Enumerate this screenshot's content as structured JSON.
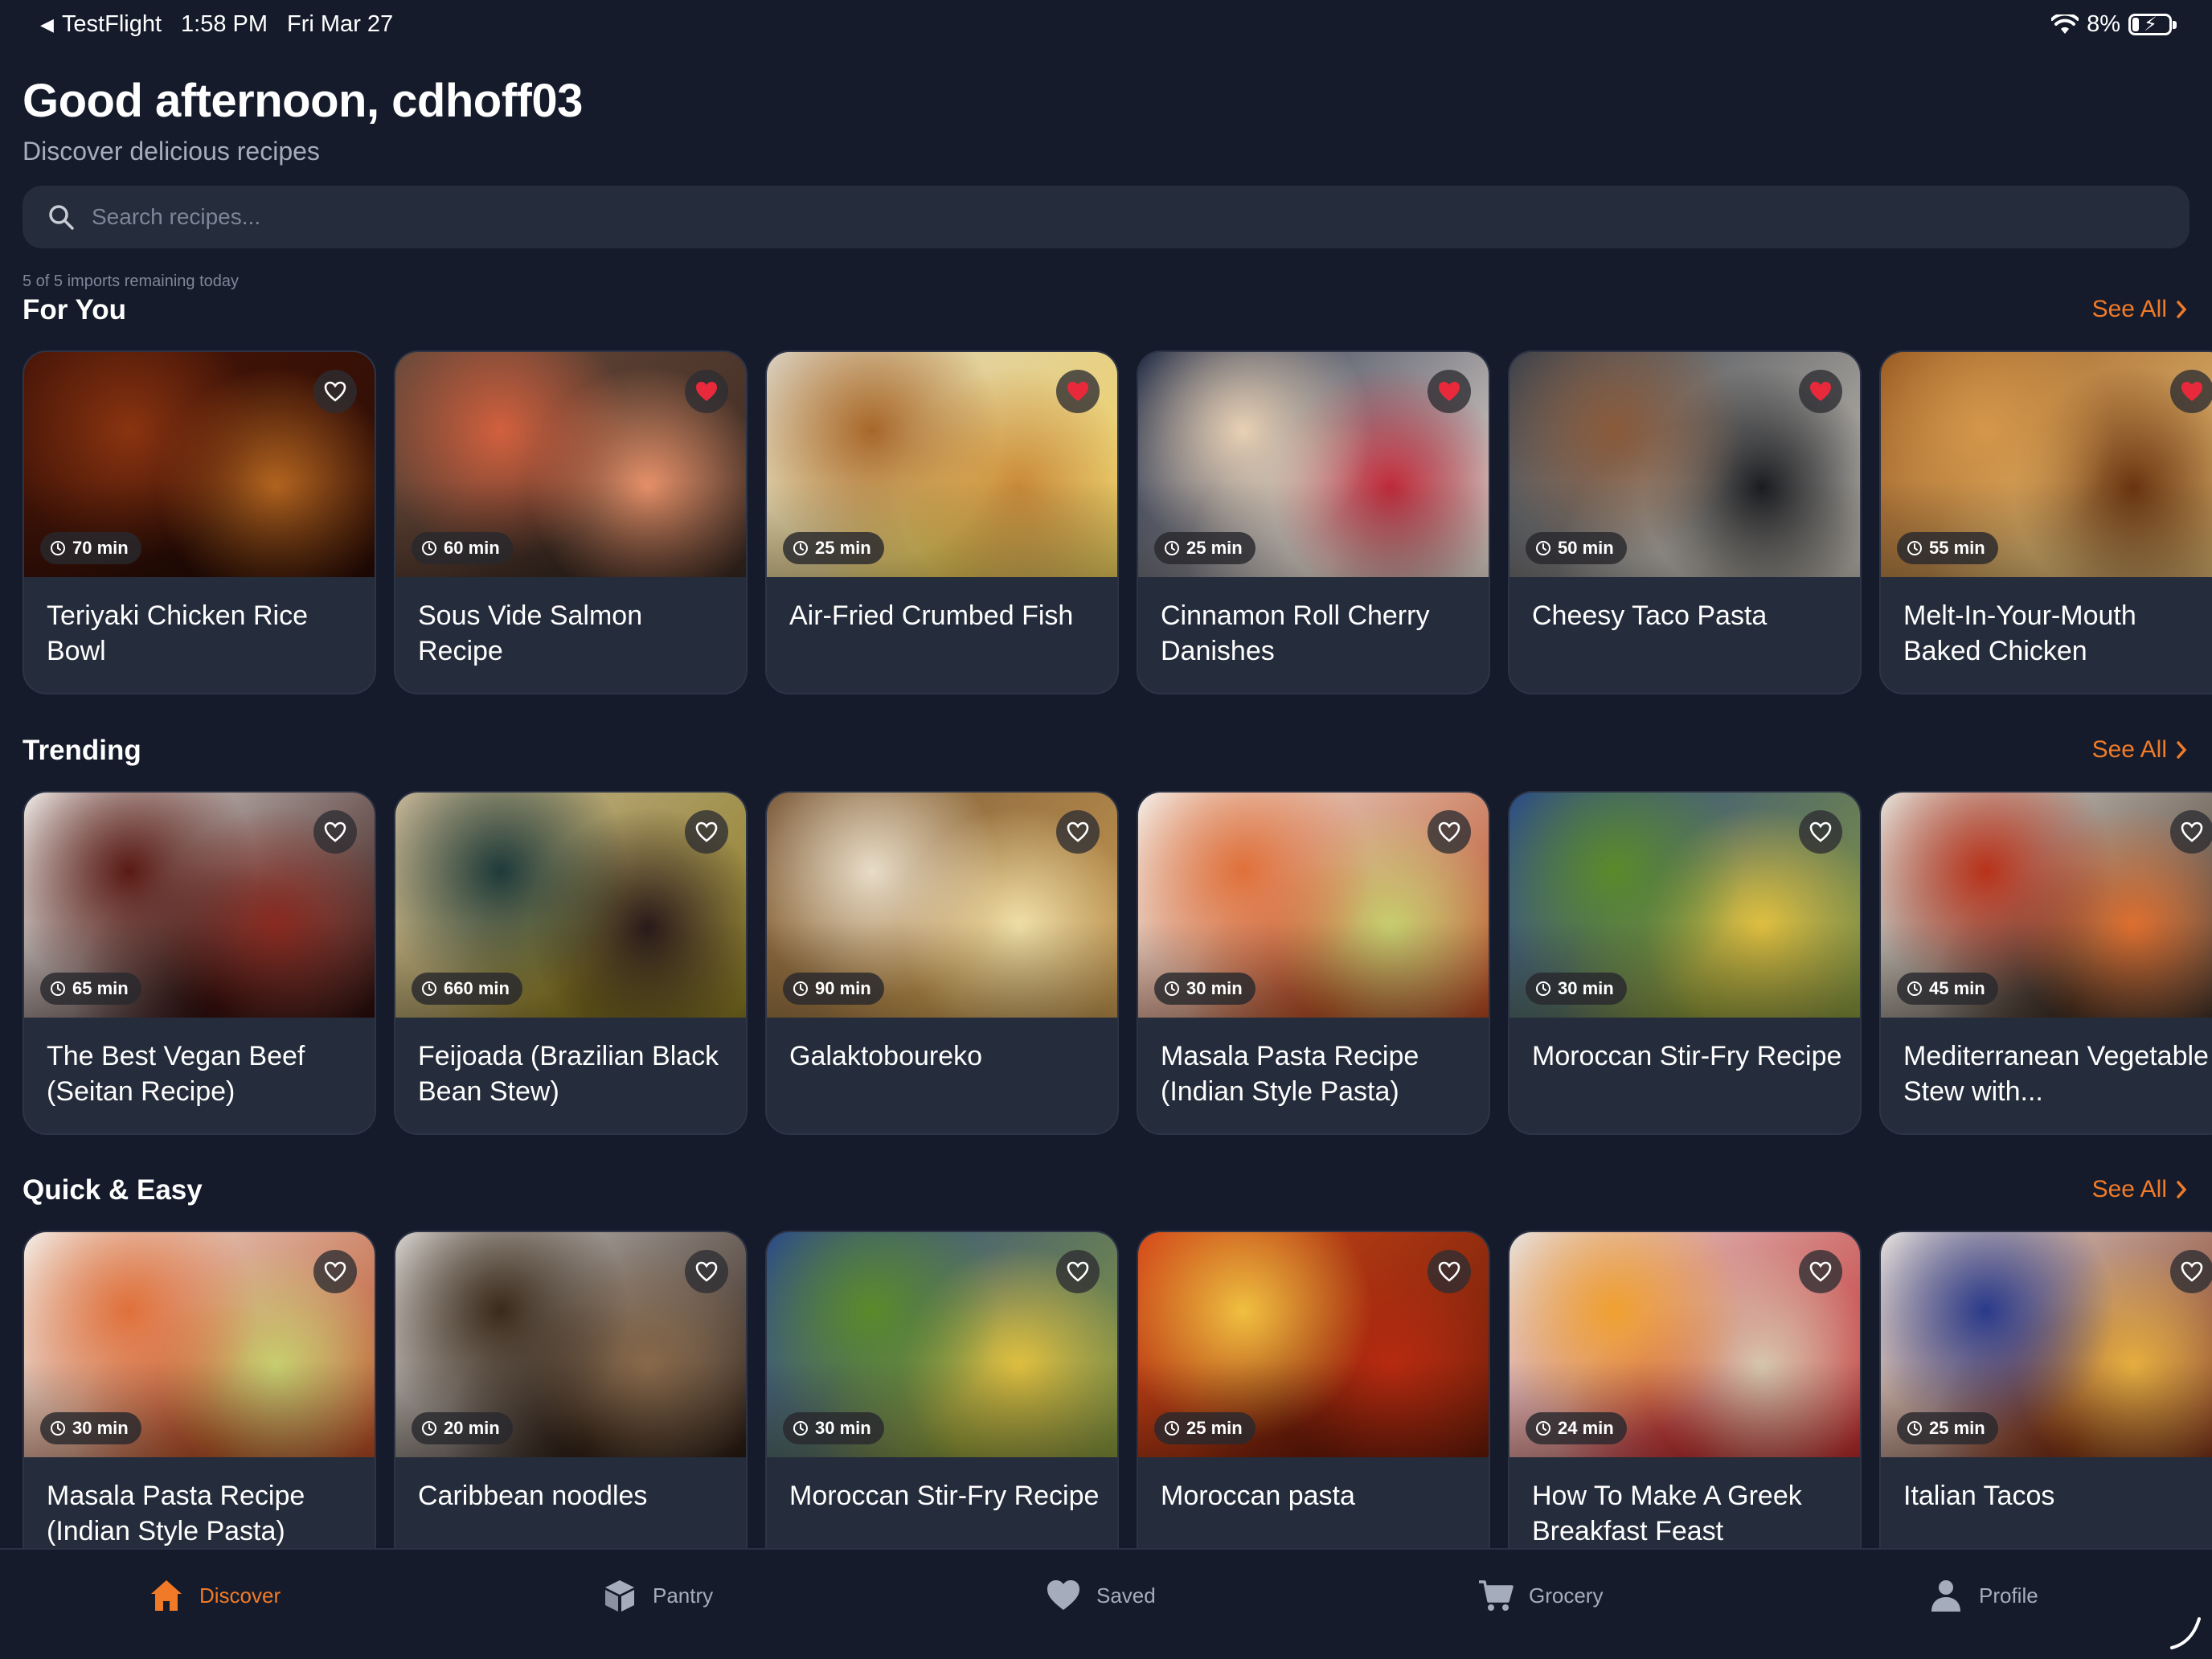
{
  "status_bar": {
    "back_app": "TestFlight",
    "time": "1:58 PM",
    "date": "Fri Mar 27",
    "battery": "8%"
  },
  "header": {
    "greeting": "Good afternoon, cdhoff03",
    "subtitle": "Discover delicious recipes"
  },
  "search": {
    "placeholder": "Search recipes..."
  },
  "imports_note": "5 of 5 imports remaining today",
  "sections": [
    {
      "title": "For You",
      "see_all": "See All",
      "cards": [
        {
          "title": "Teriyaki Chicken Rice Bowl",
          "time": "70 min",
          "favorited": false,
          "colors": [
            "#4a1608",
            "#8a3410",
            "#b4651f",
            "#2a0c05"
          ]
        },
        {
          "title": "Sous Vide Salmon Recipe",
          "time": "60 min",
          "favorited": true,
          "colors": [
            "#6a4a3a",
            "#d2603e",
            "#e8926a",
            "#3b2a22"
          ]
        },
        {
          "title": "Air-Fried Crumbed Fish",
          "time": "25 min",
          "favorited": true,
          "colors": [
            "#d9d0c2",
            "#a8672a",
            "#c98a3a",
            "#f1d25c"
          ]
        },
        {
          "title": "Cinnamon Roll Cherry Danishes",
          "time": "25 min",
          "favorited": true,
          "colors": [
            "#1f2a44",
            "#e8d0b4",
            "#c02a3a",
            "#f0e4d8"
          ]
        },
        {
          "title": "Cheesy Taco Pasta",
          "time": "50 min",
          "favorited": true,
          "colors": [
            "#3a3f48",
            "#8a5a3a",
            "#1a1c20",
            "#c8c2b8"
          ]
        },
        {
          "title": "Melt-In-Your-Mouth Baked Chicken",
          "time": "55 min",
          "favorited": true,
          "colors": [
            "#9a5a22",
            "#d4974a",
            "#6a3410",
            "#e8c27a"
          ]
        }
      ]
    },
    {
      "title": "Trending",
      "see_all": "See All",
      "cards": [
        {
          "title": "The Best Vegan Beef (Seitan Recipe)",
          "time": "65 min",
          "favorited": false,
          "colors": [
            "#f0ece8",
            "#5a1a14",
            "#8a2a20",
            "#2a0a08"
          ]
        },
        {
          "title": "Feijoada (Brazilian Black Bean Stew)",
          "time": "660 min",
          "favorited": false,
          "colors": [
            "#c8b89a",
            "#1e3a3a",
            "#2a1a1a",
            "#8a7a20"
          ]
        },
        {
          "title": "Galaktoboureko",
          "time": "90 min",
          "favorited": false,
          "colors": [
            "#7a5a3a",
            "#e8dcc8",
            "#f0e0a8",
            "#c89a50"
          ]
        },
        {
          "title": "Masala Pasta Recipe (Indian Style Pasta)",
          "time": "30 min",
          "favorited": false,
          "colors": [
            "#f4f0ea",
            "#e0703a",
            "#c8d070",
            "#b84a20"
          ]
        },
        {
          "title": "Moroccan Stir-Fry Recipe",
          "time": "30 min",
          "favorited": false,
          "colors": [
            "#2a4a8a",
            "#5a8a2a",
            "#e0c040",
            "#8a9a3a"
          ]
        },
        {
          "title": "Mediterranean Vegetable Stew with...",
          "time": "45 min",
          "favorited": false,
          "colors": [
            "#e8e4dc",
            "#b8321a",
            "#e07030",
            "#3a2a20"
          ]
        }
      ]
    },
    {
      "title": "Quick & Easy",
      "see_all": "See All",
      "cards": [
        {
          "title": "Masala Pasta Recipe (Indian Style Pasta)",
          "time": "30 min",
          "favorited": false,
          "colors": [
            "#f4f0ea",
            "#e0703a",
            "#c8d070",
            "#b84a20"
          ]
        },
        {
          "title": "Caribbean noodles",
          "time": "20 min",
          "favorited": false,
          "colors": [
            "#d8d4d0",
            "#3a2a1a",
            "#8a6a4a",
            "#2a1a10"
          ]
        },
        {
          "title": "Moroccan Stir-Fry Recipe",
          "time": "30 min",
          "favorited": false,
          "colors": [
            "#2a4a8a",
            "#5a8a2a",
            "#e0c040",
            "#8a9a3a"
          ]
        },
        {
          "title": "Moroccan pasta",
          "time": "25 min",
          "favorited": false,
          "colors": [
            "#d84a1a",
            "#f0c040",
            "#b82a10",
            "#6a1a08"
          ]
        },
        {
          "title": "How To Make A Greek Breakfast Feast",
          "time": "24 min",
          "favorited": false,
          "colors": [
            "#e8e4e0",
            "#f0a030",
            "#d8c8b0",
            "#c02a2a"
          ]
        },
        {
          "title": "Italian Tacos",
          "time": "25 min",
          "favorited": false,
          "colors": [
            "#e8e4e0",
            "#2a3a8a",
            "#e8b040",
            "#7a2a10"
          ]
        }
      ]
    }
  ],
  "nav": [
    {
      "label": "Discover",
      "icon": "home-icon",
      "active": true
    },
    {
      "label": "Pantry",
      "icon": "box-icon",
      "active": false
    },
    {
      "label": "Saved",
      "icon": "heart-icon",
      "active": false
    },
    {
      "label": "Grocery",
      "icon": "cart-icon",
      "active": false
    },
    {
      "label": "Profile",
      "icon": "person-icon",
      "active": false
    }
  ],
  "colors": {
    "background": "#151b2b",
    "card": "#252c3b",
    "accent": "#f07a28",
    "muted_text": "#a5adbc",
    "favorite_red": "#e8293b"
  }
}
